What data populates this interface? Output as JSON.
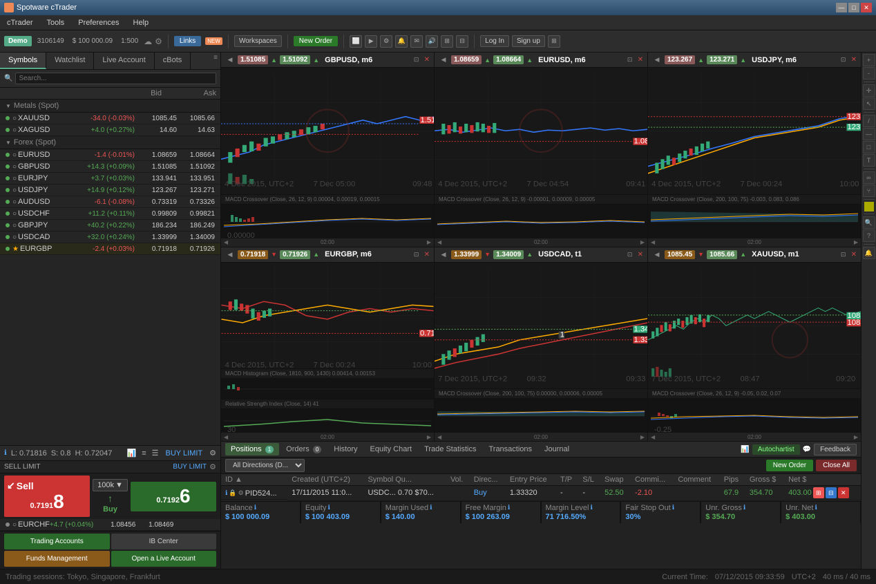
{
  "app": {
    "title": "Spotware cTrader"
  },
  "titlebar": {
    "title": "Spotware cTrader",
    "btn_min": "—",
    "btn_max": "□",
    "btn_close": "✕"
  },
  "menubar": {
    "items": [
      "cTrader",
      "Tools",
      "Preferences",
      "Help"
    ]
  },
  "toolbar": {
    "demo_label": "Demo",
    "account_id": "3106149",
    "balance": "$ 100 000.09",
    "leverage": "1:500",
    "links_label": "Links",
    "new_badge": "NEW",
    "workspaces_label": "Workspaces",
    "new_order_label": "New Order",
    "log_in_label": "Log In",
    "sign_up_label": "Sign up"
  },
  "left_panel": {
    "tabs": [
      "Symbols",
      "Watchlist",
      "Live Account",
      "cBots"
    ],
    "active_tab": "Symbols",
    "col_bid": "Bid",
    "col_ask": "Ask",
    "groups": [
      {
        "name": "Metals (Spot)",
        "symbols": [
          {
            "name": "XAUUSD",
            "change": "-34.0 (-0.03%)",
            "neg": true,
            "bid": "1085.45",
            "ask": "1085.66"
          },
          {
            "name": "XAGUSD",
            "change": "+4.0 (+0.27%)",
            "neg": false,
            "bid": "14.60",
            "ask": "14.63"
          }
        ]
      },
      {
        "name": "Forex (Spot)",
        "symbols": [
          {
            "name": "EURUSD",
            "change": "-1.4 (-0.01%)",
            "neg": true,
            "bid": "1.08659",
            "ask": "1.08664"
          },
          {
            "name": "GBPUSD",
            "change": "+14.3 (+0.09%)",
            "neg": false,
            "bid": "1.51085",
            "ask": "1.51092"
          },
          {
            "name": "EURJPY",
            "change": "+3.7 (+0.03%)",
            "neg": false,
            "bid": "133.941",
            "ask": "133.951"
          },
          {
            "name": "USDJPY",
            "change": "+14.9 (+0.12%)",
            "neg": false,
            "bid": "123.267",
            "ask": "123.271"
          },
          {
            "name": "AUDUSD",
            "change": "-6.1 (-0.08%)",
            "neg": true,
            "bid": "0.73319",
            "ask": "0.73326"
          },
          {
            "name": "USDCHF",
            "change": "+11.2 (+0.11%)",
            "neg": false,
            "bid": "0.99809",
            "ask": "0.99821"
          },
          {
            "name": "GBPJPY",
            "change": "+40.2 (+0.22%)",
            "neg": false,
            "bid": "186.234",
            "ask": "186.249"
          },
          {
            "name": "USDCAD",
            "change": "+32.0 (+0.24%)",
            "neg": false,
            "bid": "1.33999",
            "ask": "1.34009"
          },
          {
            "name": "EURGBP",
            "change": "-2.4 (+0.03%)",
            "neg": true,
            "bid": "0.71918",
            "ask": "0.71926",
            "starred": true
          },
          {
            "name": "EURCHF",
            "change": "+4.7 (+0.04%)",
            "neg": false,
            "bid": "1.08456",
            "ask": "1.08469"
          }
        ]
      }
    ],
    "spread_L": "L: 0.71816",
    "spread_S": "S: 0.8",
    "spread_H": "H: 0.72047",
    "sell_label": "Sell",
    "buy_label": "Buy",
    "lot_size": "100k",
    "sell_price": "0.7191",
    "sell_price_big": "8",
    "buy_price": "0.7192",
    "buy_price_big": "6"
  },
  "charts": [
    {
      "id": "chart1",
      "title": "GBPUSD, m6",
      "price1": "1.51085",
      "price2": "1.51092",
      "price1_dir": "up",
      "price2_dir": "up",
      "indicator": "MACD Crossover (Close, 26, 12, 9) 0.00004, 0.00019, 0.00015"
    },
    {
      "id": "chart2",
      "title": "EURUSD, m6",
      "price1": "1.08659",
      "price2": "1.08664",
      "price1_dir": "up",
      "price2_dir": "up",
      "indicator": "MACD Crossover (Close, 26, 12, 9) -0.00001, 0.00009, 0.00005"
    },
    {
      "id": "chart3",
      "title": "USDJPY, m6",
      "price1": "123.267",
      "price2": "123.271",
      "price1_dir": "up",
      "price2_dir": "up",
      "indicator": "MACD Crossover (Close, 200, 100, 75) -0.003, 0.083, 0.086"
    },
    {
      "id": "chart4",
      "title": "EURGBP, m6",
      "price1": "0.71918",
      "price2": "0.71926",
      "price1_dir": "down",
      "price2_dir": "up",
      "indicator": "MACD Histogram (Close, 1810, 900, 1430) 0.00414, 0.00153",
      "indicator2": "Relative Strength Index (Close, 14) 41"
    },
    {
      "id": "chart5",
      "title": "USDCAD, t1",
      "price1": "1.33999",
      "price2": "1.34009",
      "price1_dir": "down",
      "price2_dir": "up",
      "indicator": "MACD Crossover (Close, 200, 100, 75) 0.00000, 0.00006, 0.00005"
    },
    {
      "id": "chart6",
      "title": "XAUUSD, m1",
      "price1": "1085.45",
      "price2": "1085.66",
      "price1_dir": "down",
      "price2_dir": "up",
      "indicator": "MACD Crossover (Close, 26, 12, 9) -0.05, 0.02, 0.07"
    }
  ],
  "trading_panel": {
    "tabs": [
      {
        "label": "Positions",
        "badge": "1",
        "badge_zero": false
      },
      {
        "label": "Orders",
        "badge": "0",
        "badge_zero": true
      },
      {
        "label": "History",
        "badge": null
      },
      {
        "label": "Equity Chart",
        "badge": null
      },
      {
        "label": "Trade Statistics",
        "badge": null
      },
      {
        "label": "Transactions",
        "badge": null
      },
      {
        "label": "Journal",
        "badge": null
      }
    ],
    "filter": "All Directions (D...",
    "autochartist": "Autochartist",
    "feedback": "Feedback",
    "new_order": "New Order",
    "close_all": "Close All",
    "columns": [
      "ID ▲",
      "Created (UTC+2)",
      "Symbol Qu...",
      "Vol.",
      "Direc...",
      "Entry Price",
      "T/P",
      "S/L",
      "Swap",
      "Commi...",
      "Comment",
      "Pips",
      "Gross $",
      "Net $"
    ],
    "positions": [
      {
        "id": "PID524...",
        "created": "17/11/2015 11:0...",
        "symbol": "USDC...",
        "vol": "0.70",
        "vol2": "$70...",
        "direction": "Buy",
        "entry": "1.33320",
        "tp": "-",
        "sl": "-",
        "swap": "52.50",
        "commission": "-2.10",
        "comment": "",
        "pips": "67.9",
        "gross": "354.70",
        "net": "403.00"
      }
    ],
    "stats": {
      "balance_label": "Balance",
      "balance_value": "$ 100 000.09",
      "equity_label": "Equity",
      "equity_value": "$ 100 403.09",
      "margin_used_label": "Margin Used",
      "margin_used_value": "$ 140.00",
      "free_margin_label": "Free Margin",
      "free_margin_value": "$ 100 263.09",
      "margin_level_label": "Margin Level",
      "margin_level_value": "71 716.50%",
      "fair_stop_label": "Fair Stop Out",
      "fair_stop_value": "30%",
      "unr_gross_label": "Unr. Gross",
      "unr_gross_value": "$ 354.70",
      "unr_net_label": "Unr. Net",
      "unr_net_value": "$ 403.00"
    }
  },
  "bottom_buttons": {
    "trading_accounts": "Trading Accounts",
    "ib_center": "IB Center",
    "funds_management": "Funds Management",
    "open_live_account": "Open a Live Account"
  },
  "statusbar": {
    "left": "Trading sessions:  Tokyo, Singapore, Frankfurt",
    "current_time_label": "Current Time:",
    "time": "07/12/2015 09:33:59",
    "timezone": "UTC+2",
    "ping": "40 ms / 40 ms"
  }
}
